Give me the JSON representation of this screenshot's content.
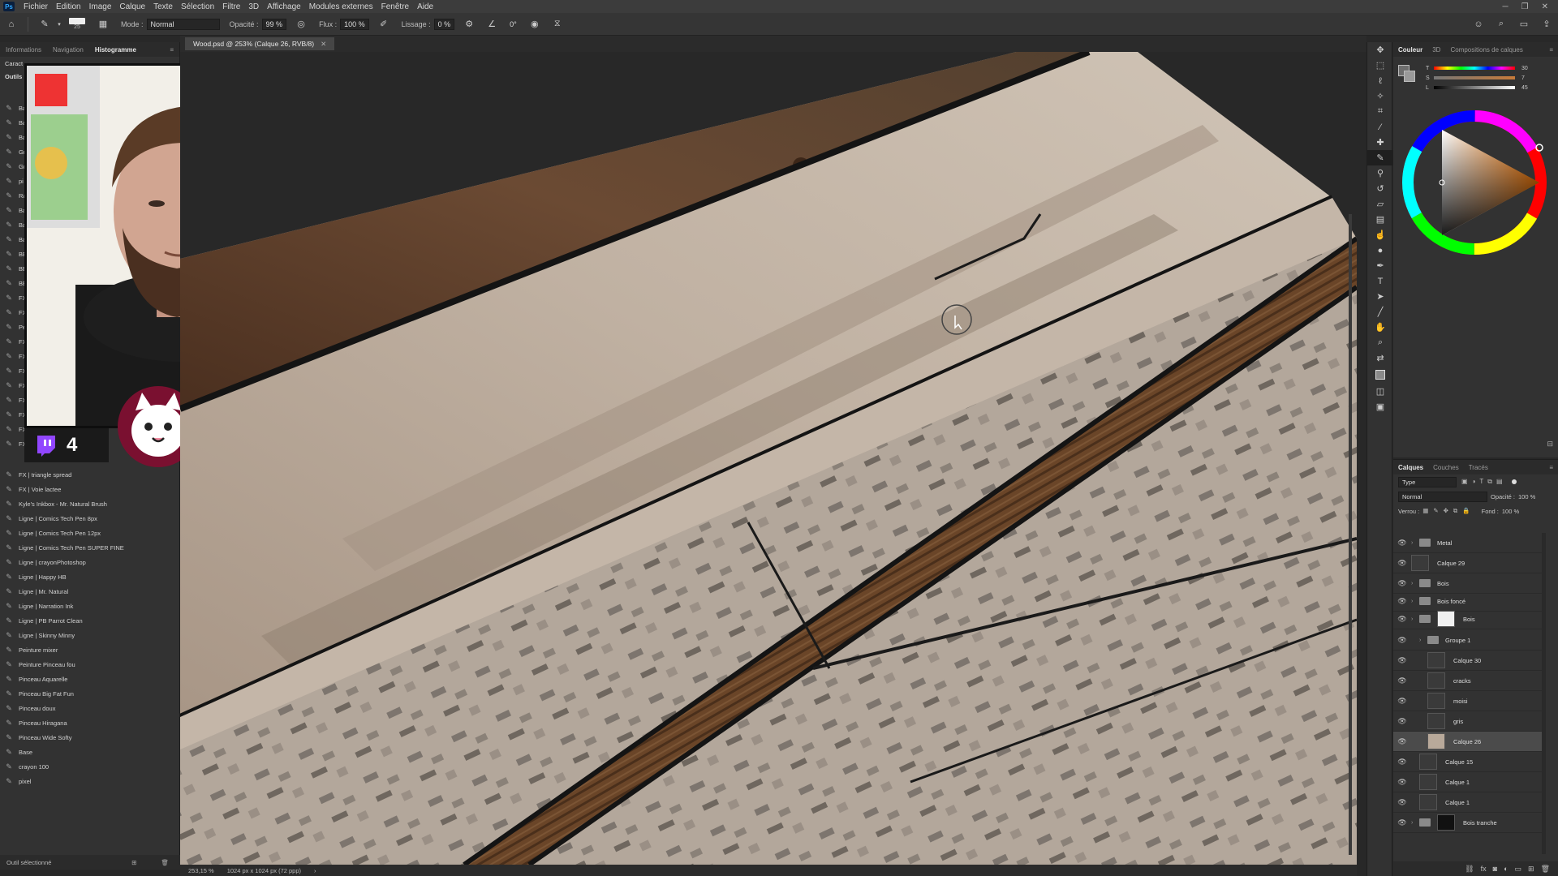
{
  "menubar": {
    "logo": "Ps",
    "items": [
      "Fichier",
      "Edition",
      "Image",
      "Calque",
      "Texte",
      "Sélection",
      "Filtre",
      "3D",
      "Affichage",
      "Modules externes",
      "Fenêtre",
      "Aide"
    ]
  },
  "options": {
    "brush_size": "25",
    "mode_label": "Mode :",
    "mode_value": "Normal",
    "opacity_label": "Opacité :",
    "opacity_value": "99 %",
    "flow_label": "Flux :",
    "flow_value": "100 %",
    "smoothing_label": "Lissage :",
    "smoothing_value": "0 %",
    "angle_value": "0°"
  },
  "left_panel": {
    "tabs": [
      "Informations",
      "Navigation",
      "Histogramme"
    ],
    "active_tab": "Histogramme",
    "sub_labels": [
      "Caract",
      "Outils"
    ],
    "hidden_brushes": [
      "Ba",
      "Ba",
      "Ba",
      "Gr",
      "Gr",
      "pi",
      "Ra",
      "Ba",
      "Ba",
      "Ba",
      "BE",
      "BE",
      "BE",
      "FX",
      "FX",
      "Pe",
      "FX",
      "FX",
      "FX",
      "FX",
      "FX",
      "FX",
      "FX",
      "FX"
    ],
    "brushes": [
      "FX | triangle spread",
      "FX | Voie lactee",
      "Kyle's Inkbox - Mr. Natural Brush",
      "Ligne | Comics Tech Pen 8px",
      "Ligne | Comics Tech Pen 12px",
      "Ligne | Comics Tech Pen SUPER FINE",
      "Ligne | crayonPhotoshop",
      "Ligne | Happy HB",
      "Ligne | Mr. Natural",
      "Ligne | Narration Ink",
      "Ligne | PB Parrot Clean",
      "Ligne | Skinny Minny",
      "Peinture mixer",
      "Peinture Pinceau fou",
      "Pinceau Aquarelle",
      "Pinceau Big Fat Fun",
      "Pinceau doux",
      "Pinceau Hiragana",
      "Pinceau Wide Softy",
      "Base",
      "crayon 100",
      "pixel"
    ],
    "status": "Outil sélectionné"
  },
  "webcam": {
    "twitch_count": "4"
  },
  "document": {
    "tab_title": "Wood.psd @ 253% (Calque 26, RVB/8)",
    "zoom": "253,15 %",
    "size": "1024 px x 1024 px (72 ppp)"
  },
  "color_panel": {
    "tabs": [
      "Couleur",
      "3D",
      "Compositions de calques"
    ],
    "active_tab": "Couleur",
    "sliders": [
      {
        "label": "T",
        "value": "30"
      },
      {
        "label": "S",
        "value": "7"
      },
      {
        "label": "L",
        "value": "45"
      }
    ],
    "percent": "%"
  },
  "layers_panel": {
    "tabs": [
      "Calques",
      "Couches",
      "Tracés"
    ],
    "active_tab": "Calques",
    "filter_label": "Type",
    "blend_mode": "Normal",
    "opacity_label": "Opacité :",
    "opacity_value": "100 %",
    "lock_label": "Verrou :",
    "fill_label": "Fond :",
    "fill_value": "100 %",
    "layers": [
      {
        "name": "Metal",
        "kind": "group",
        "indent": 0
      },
      {
        "name": "Calque 29",
        "kind": "layer",
        "indent": 0
      },
      {
        "name": "Bois",
        "kind": "group",
        "indent": 0
      },
      {
        "name": "Bois foncé",
        "kind": "group",
        "indent": 0
      },
      {
        "name": "Bois",
        "kind": "masked-group",
        "indent": 0
      },
      {
        "name": "Groupe 1",
        "kind": "group",
        "indent": 1
      },
      {
        "name": "Calque 30",
        "kind": "layer",
        "indent": 2
      },
      {
        "name": "cracks",
        "kind": "layer",
        "indent": 2
      },
      {
        "name": "moisi",
        "kind": "layer",
        "indent": 2
      },
      {
        "name": "gris",
        "kind": "layer",
        "indent": 2
      },
      {
        "name": "Calque 26",
        "kind": "layer",
        "indent": 2,
        "selected": true
      },
      {
        "name": "Calque 15",
        "kind": "layer",
        "indent": 1
      },
      {
        "name": "Calque 1",
        "kind": "layer",
        "indent": 1
      },
      {
        "name": "Calque 1",
        "kind": "layer",
        "indent": 1
      },
      {
        "name": "Bois tranche",
        "kind": "masked-group",
        "indent": 0
      }
    ]
  },
  "colors": {
    "workspace": "#282828",
    "panel": "#323232",
    "light_wood": "#b8a99a",
    "dark_wood": "#5a3a22",
    "rust": "#6b4a33",
    "selected_layer": "#4b4b4b"
  }
}
